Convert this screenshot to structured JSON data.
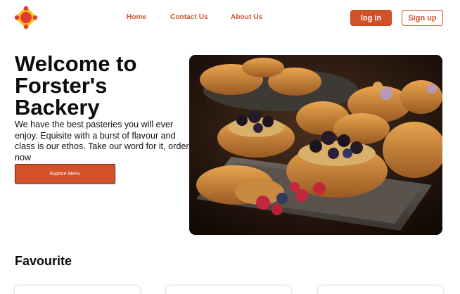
{
  "nav": {
    "home": "Home",
    "contact": "Contact Us",
    "about": "About Us"
  },
  "auth": {
    "login": "log in",
    "signup": "Sign up"
  },
  "hero": {
    "title": "Welcome to Forster's Backery",
    "text": "We have the best pasteries you will ever enjoy. Equisite with a burst of flavour and class is our ethos. Take our word for it, order now",
    "cta": "Explore Menu",
    "image_alt": "Tray of pastries with berries"
  },
  "favourites": {
    "title": "Favourite",
    "cards": [
      {},
      {},
      {}
    ]
  },
  "colors": {
    "accent": "#d2512b",
    "logo_outer": "#e23b2e",
    "logo_inner": "#f5c518"
  }
}
